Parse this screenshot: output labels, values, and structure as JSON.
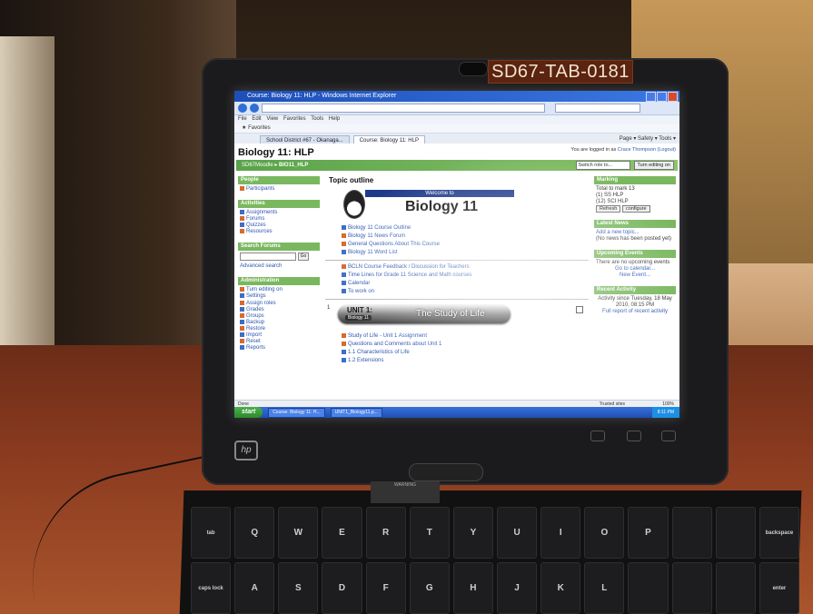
{
  "tablet_label": "SD67-TAB-0181",
  "browser": {
    "window_title": "Course: Biology 11: HLP - Windows Internet Explorer",
    "menu": [
      "File",
      "Edit",
      "View",
      "Favorites",
      "Tools",
      "Help"
    ],
    "favorites_label": "Favorites",
    "tabs": [
      "School District #67 - Okanaga...",
      "Course: Biology 11: HLP"
    ],
    "toolbar_right": "Page ▾  Safety ▾  Tools ▾"
  },
  "page": {
    "course_title": "Biology 11: HLP",
    "login_prefix": "You are logged in as",
    "login_user": "Crace Thompson (Logout)",
    "breadcrumb_site": "SD67Moodle",
    "breadcrumb_course": "BIO11_HLP",
    "switch_role": "Switch role to...",
    "turn_editing": "Turn editing on",
    "left": {
      "people": {
        "title": "People",
        "items": [
          "Participants"
        ]
      },
      "activities": {
        "title": "Activities",
        "items": [
          "Assignments",
          "Forums",
          "Quizzes",
          "Resources"
        ]
      },
      "search": {
        "title": "Search Forums",
        "go": "Go",
        "advanced": "Advanced search"
      },
      "admin": {
        "title": "Administration",
        "items": [
          "Turn editing on",
          "Settings",
          "Assign roles",
          "Grades",
          "Groups",
          "Backup",
          "Restore",
          "Import",
          "Reset",
          "Reports"
        ]
      }
    },
    "middle": {
      "topic_outline": "Topic outline",
      "welcome_banner": "Welcome to",
      "welcome_big": "Biology 11",
      "links_a": [
        "Biology 11 Course Outline",
        "Biology 11 News Forum",
        "General Questions About This Course",
        "Biology 11 Word List"
      ],
      "links_b": [
        "BCLN Course Feedback / Discussion for Teachers",
        "Time Lines for Grade 11 Science and Math courses",
        "Calendar",
        "To work on"
      ],
      "unit_num": "1",
      "unit_title": "UNIT 1:",
      "unit_sub": "Biology 11",
      "unit_study": "The Study of Life",
      "links_c": [
        "Study of Life - Unit 1 Assignment",
        "Questions and Comments about Unit 1",
        "1.1 Characteristics of Life",
        "1.2 Extensions"
      ]
    },
    "right": {
      "marking": {
        "title": "Marking",
        "total": "Total to mark 13",
        "items": [
          "(1) SS HLP",
          "(12) SCI HLP"
        ],
        "refresh": "Refresh",
        "configure": "configure"
      },
      "latest_news": {
        "title": "Latest News",
        "add": "Add a new topic...",
        "none": "(No news has been posted yet)"
      },
      "upcoming": {
        "title": "Upcoming Events",
        "text": "There are no upcoming events",
        "goto": "Go to calendar...",
        "new": "New Event..."
      },
      "recent": {
        "title": "Recent Activity",
        "since": "Activity since Tuesday, 18 May 2010, 08:15 PM",
        "full": "Full report of recent activity"
      }
    },
    "status_left": "Done",
    "status_right": "Trusted sites",
    "zoom": "100%"
  },
  "taskbar": {
    "start": "start",
    "tasks": [
      "Course: Biology 11: H...",
      "UNIT1_Biology11.p..."
    ],
    "clock": "8:11 PM"
  },
  "laptop": {
    "brand": "hp",
    "warning": "WARNING",
    "keys_row1": [
      "Q",
      "W",
      "E",
      "R",
      "T",
      "Y",
      "U",
      "I",
      "O",
      "P"
    ],
    "keys_row2": [
      "A",
      "S",
      "D",
      "F",
      "G",
      "H",
      "J",
      "K",
      "L"
    ],
    "key_backspace": "backspace",
    "key_tab": "tab",
    "key_caps": "caps lock",
    "key_enter": "enter"
  }
}
